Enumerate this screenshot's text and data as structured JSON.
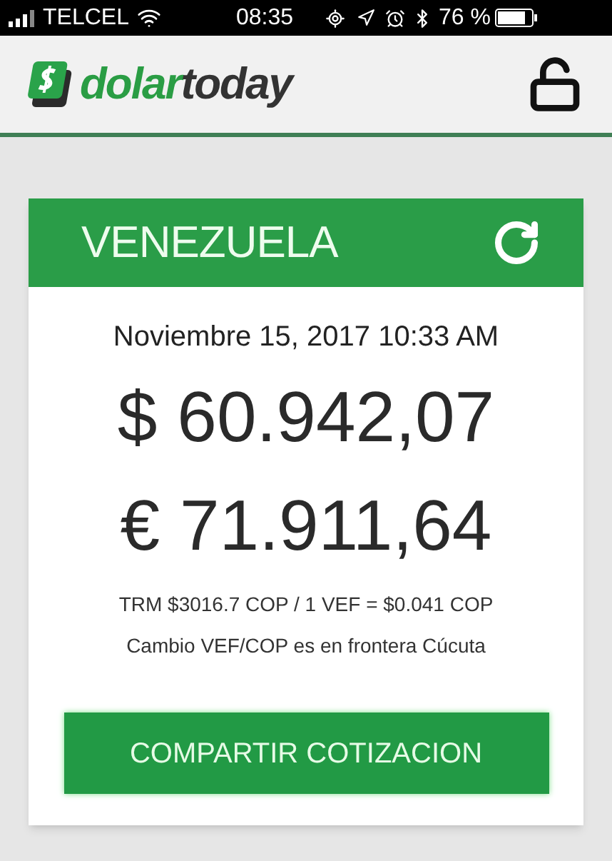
{
  "status_bar": {
    "carrier": "TELCEL",
    "time": "08:35",
    "battery": "76 %"
  },
  "header": {
    "logo": {
      "first": "dolar",
      "second": "today"
    }
  },
  "card": {
    "title": "VENEZUELA",
    "date": "Noviembre 15, 2017 10:33 AM",
    "rates": [
      {
        "symbol": "$",
        "value": "60.942,07"
      },
      {
        "symbol": "€",
        "value": "71.911,64"
      }
    ],
    "notes": [
      "TRM $3016.7 COP / 1 VEF = $0.041 COP",
      "Cambio VEF/COP es en frontera Cúcuta"
    ],
    "button": "COMPARTIR COTIZACION"
  }
}
